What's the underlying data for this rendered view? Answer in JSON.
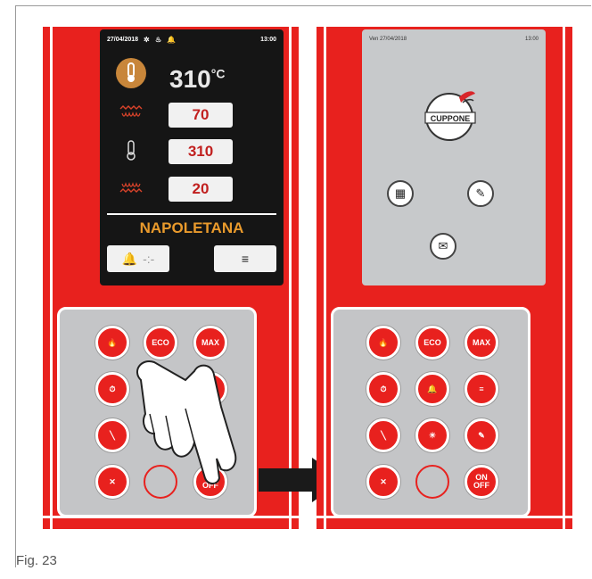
{
  "figure": {
    "caption": "Fig. 23"
  },
  "left_display": {
    "date": "27/04/2018",
    "time": "13:00",
    "main_temp": "310",
    "main_temp_unit": "°C",
    "rows": [
      {
        "icon": "top-heater-icon",
        "value": "70"
      },
      {
        "icon": "thermometer-icon",
        "value": "310"
      },
      {
        "icon": "bottom-heater-icon",
        "value": "20"
      }
    ],
    "program_name": "NAPOLETANA",
    "soft_buttons": [
      {
        "icon": "bell-icon",
        "label": "-:-"
      },
      {
        "icon": "document-icon",
        "label": "≡"
      }
    ]
  },
  "right_display": {
    "date": "Ven 27/04/2018",
    "time": "13:00",
    "logo_text": "CUPPONE",
    "menu_icons": [
      "calendar-clock-icon",
      "recipe-book-icon",
      "message-icon"
    ]
  },
  "keypad_left": {
    "keys": [
      {
        "name": "flame-key",
        "label": "🔥"
      },
      {
        "name": "eco-key",
        "label": "ECO"
      },
      {
        "name": "max-key",
        "label": "MAX"
      },
      {
        "name": "clock-key",
        "label": "⏱"
      },
      {
        "name": "blank-key-1",
        "label": ""
      },
      {
        "name": "document-key",
        "label": "≡"
      },
      {
        "name": "oven-door-key",
        "label": "╲"
      },
      {
        "name": "blank-key-2",
        "label": ""
      },
      {
        "name": "recipe-key",
        "label": "✎"
      },
      {
        "name": "tools-key",
        "label": "✕"
      },
      {
        "name": "empty-key",
        "label": ""
      },
      {
        "name": "on-off-key",
        "label": "ON OFF"
      }
    ]
  },
  "keypad_right": {
    "keys": [
      {
        "name": "flame-key",
        "label": "🔥"
      },
      {
        "name": "eco-key",
        "label": "ECO"
      },
      {
        "name": "max-key",
        "label": "MAX"
      },
      {
        "name": "clock-key",
        "label": "⏱"
      },
      {
        "name": "bell-key",
        "label": "🔔"
      },
      {
        "name": "document-key",
        "label": "≡"
      },
      {
        "name": "oven-door-key",
        "label": "╲"
      },
      {
        "name": "light-key",
        "label": "☀"
      },
      {
        "name": "recipe-key",
        "label": "✎"
      },
      {
        "name": "tools-key",
        "label": "✕"
      },
      {
        "name": "empty-key",
        "label": ""
      },
      {
        "name": "on-off-key",
        "label": "ON OFF"
      }
    ]
  },
  "colors": {
    "panel_red": "#e8211e",
    "program_orange": "#e99a2c",
    "keypad_gray": "#c4c5c7"
  }
}
